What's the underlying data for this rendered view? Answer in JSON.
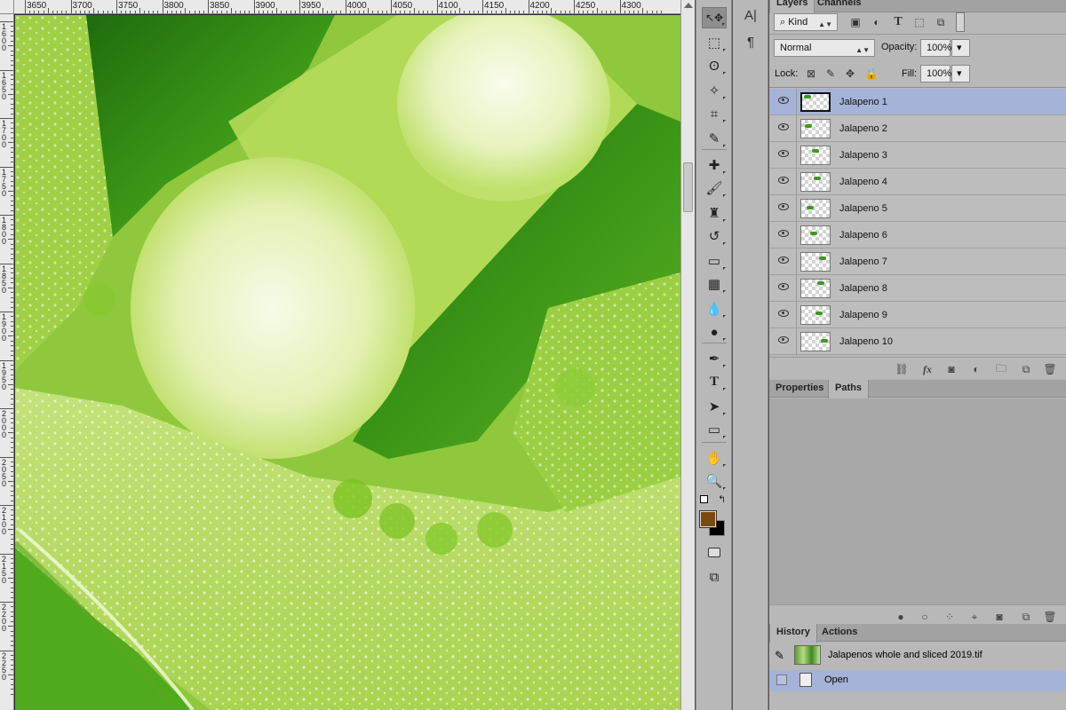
{
  "ruler": {
    "top_labels": [
      "3650",
      "3700",
      "3750",
      "3800",
      "3850",
      "3900",
      "3950",
      "4000",
      "4050",
      "4100",
      "4150",
      "4200",
      "4250",
      "4300"
    ],
    "left_labels": [
      "1600",
      "1650",
      "1700",
      "1750",
      "1800",
      "1850",
      "1900",
      "1950",
      "2000",
      "2050",
      "2100",
      "2150",
      "2200",
      "2250"
    ]
  },
  "tools": [
    {
      "icon": "move-icon",
      "glyph": "↖✥"
    },
    {
      "icon": "marquee-icon",
      "glyph": "⬚"
    },
    {
      "icon": "lasso-icon",
      "glyph": "ʘ"
    },
    {
      "icon": "quick-select-icon",
      "glyph": "✧"
    },
    {
      "icon": "crop-icon",
      "glyph": "⌗"
    },
    {
      "icon": "eyedropper-icon",
      "glyph": "✎"
    },
    {
      "icon": "healing-brush-icon",
      "glyph": "✚"
    },
    {
      "icon": "brush-icon",
      "glyph": "🖌"
    },
    {
      "icon": "clone-stamp-icon",
      "glyph": "♜"
    },
    {
      "icon": "history-brush-icon",
      "glyph": "↺"
    },
    {
      "icon": "eraser-icon",
      "glyph": "▭"
    },
    {
      "icon": "gradient-icon",
      "glyph": "▦"
    },
    {
      "icon": "blur-icon",
      "glyph": "💧"
    },
    {
      "icon": "dodge-icon",
      "glyph": "●"
    },
    {
      "icon": "pen-icon",
      "glyph": "✒"
    },
    {
      "icon": "type-icon",
      "glyph": "T"
    },
    {
      "icon": "path-select-icon",
      "glyph": "➤"
    },
    {
      "icon": "rectangle-shape-icon",
      "glyph": "▭"
    },
    {
      "icon": "hand-icon",
      "glyph": "✋"
    },
    {
      "icon": "zoom-icon",
      "glyph": "🔍"
    }
  ],
  "colors": {
    "foreground": "#7a4a0e",
    "background": "#000000",
    "selection": "#a6b3d8",
    "panel": "#b8b8b8"
  },
  "mini_panel": {
    "char_glyph": "A|",
    "para_glyph": "¶"
  },
  "layers_panel": {
    "tabs": [
      "Layers",
      "Channels"
    ],
    "filter_kind": "Kind",
    "blend_mode": "Normal",
    "opacity_label": "Opacity:",
    "opacity_value": "100%",
    "lock_label": "Lock:",
    "fill_label": "Fill:",
    "fill_value": "100%",
    "layers": [
      {
        "name": "Jalapeno 1",
        "selected": true
      },
      {
        "name": "Jalapeno 2",
        "selected": false
      },
      {
        "name": "Jalapeno 3",
        "selected": false
      },
      {
        "name": "Jalapeno 4",
        "selected": false
      },
      {
        "name": "Jalapeno 5",
        "selected": false
      },
      {
        "name": "Jalapeno 6",
        "selected": false
      },
      {
        "name": "Jalapeno 7",
        "selected": false
      },
      {
        "name": "Jalapeno 8",
        "selected": false
      },
      {
        "name": "Jalapeno 9",
        "selected": false
      },
      {
        "name": "Jalapeno 10",
        "selected": false
      }
    ],
    "footer_icons": [
      "link-icon",
      "fx-icon",
      "mask-icon",
      "adjustment-icon",
      "group-folder-icon",
      "new-layer-icon",
      "trash-icon"
    ]
  },
  "properties_panel": {
    "tabs": [
      "Properties",
      "Paths"
    ],
    "active_tab": "Paths"
  },
  "history_panel": {
    "tabs": [
      "History",
      "Actions"
    ],
    "snapshot_name": "Jalapenos whole and sliced 2019.tif",
    "states": [
      {
        "label": "Open",
        "selected": true
      }
    ]
  }
}
